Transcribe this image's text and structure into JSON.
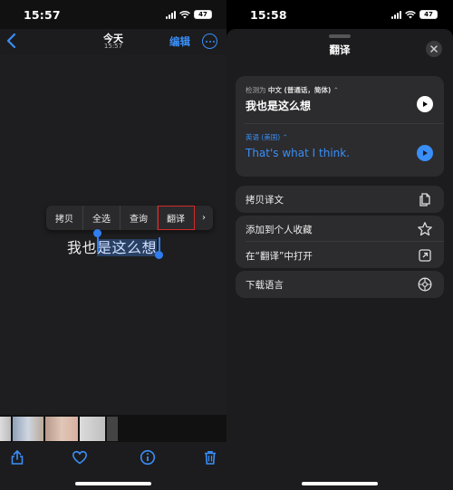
{
  "left": {
    "status": {
      "time": "15:57",
      "battery": "47"
    },
    "nav": {
      "title": "今天",
      "subtitle": "15:57",
      "edit_label": "编辑"
    },
    "menu_items": [
      {
        "label": "拷贝"
      },
      {
        "label": "全选"
      },
      {
        "label": "查询"
      },
      {
        "label": "翻译"
      },
      {
        "label": "›"
      }
    ],
    "photo_text": {
      "plain": "我也",
      "selected": "是这么想"
    },
    "toolbar_icons": [
      "share-icon",
      "heart-icon",
      "info-icon",
      "trash-icon"
    ]
  },
  "right": {
    "status": {
      "time": "15:58",
      "battery": "47"
    },
    "sheet_title": "翻译",
    "source": {
      "prefix": "检测为",
      "language": "中文 (普通话，简体)",
      "text": "我也是这么想"
    },
    "target": {
      "language": "英语 (美国)",
      "text": "That's what I think."
    },
    "actions_group1": [
      {
        "label": "拷贝译文",
        "icon": "copy-icon"
      }
    ],
    "actions_group2": [
      {
        "label": "添加到个人收藏",
        "icon": "star-icon"
      },
      {
        "label": "在“翻译”中打开",
        "icon": "open-external-icon"
      }
    ],
    "actions_group3": [
      {
        "label": "下载语言",
        "icon": "settings-icon"
      }
    ]
  },
  "colors": {
    "accent": "#3a8ef6",
    "highlight_box": "#d42a2a",
    "sheet_bg": "#1c1c1e",
    "card_bg": "#2c2c2e"
  }
}
